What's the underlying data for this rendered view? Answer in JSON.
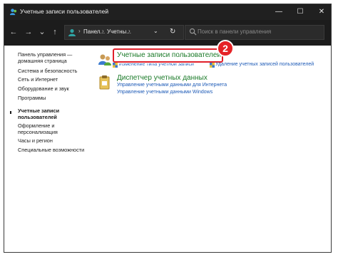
{
  "window": {
    "title": "Учетные записи пользователей",
    "minimize_glyph": "—",
    "maximize_glyph": "☐",
    "close_glyph": "✕"
  },
  "toolbar": {
    "back_glyph": "←",
    "forward_glyph": "→",
    "recent_glyph": "⌄",
    "up_glyph": "↑",
    "breadcrumbs": [
      "Панел...",
      "Учетны..."
    ],
    "breadcrumb_sep": "›",
    "dropdown_glyph": "⌄",
    "refresh_glyph": "↻",
    "search_placeholder": "Поиск в панели управления"
  },
  "sidebar": {
    "items": [
      {
        "label": "Панель управления —"
      },
      {
        "label": "домашняя страница"
      },
      {
        "label": "Система и безопасность"
      },
      {
        "label": "Сеть и Интернет"
      },
      {
        "label": "Оборудование и звук"
      },
      {
        "label": "Программы"
      },
      {
        "label": "Учетные записи"
      },
      {
        "label": "пользователей"
      },
      {
        "label": "Оформление и"
      },
      {
        "label": "персонализация"
      },
      {
        "label": "Часы и регион"
      },
      {
        "label": "Специальные возможности"
      }
    ]
  },
  "main": {
    "user_accounts": {
      "title": "Учетные записи пользователей",
      "links": [
        "Изменение типа учетной записи",
        "Удаление учетных записей пользователей"
      ]
    },
    "credential_manager": {
      "title": "Диспетчер учетных данных",
      "links": [
        "Управление учетными данными для Интернета",
        "Управление учетными данными Windows"
      ]
    }
  },
  "annotation": {
    "step_number": "2",
    "color": "#e52226"
  },
  "colors": {
    "titlebar": "#202020",
    "category_title": "#1a7a28",
    "link": "#1e5bb7"
  }
}
